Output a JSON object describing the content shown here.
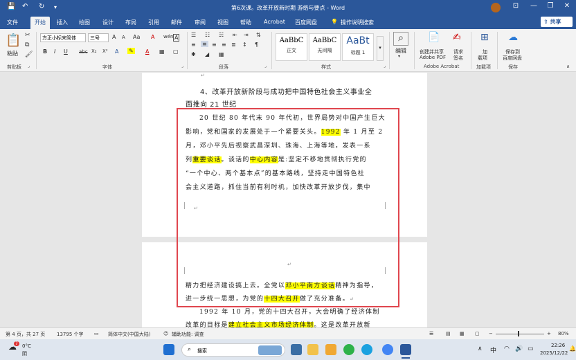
{
  "titlebar": {
    "title": "第6次课。改革开放新时期 游络与要点 - Word",
    "save_icon": "save-icon",
    "undo_icon": "undo-icon",
    "redo_icon": "redo-icon",
    "customize_icon": "chevron-down-icon",
    "minimize": "—",
    "restore": "❐",
    "close": "✕",
    "ribbon_toggle": "⊡"
  },
  "tabs": [
    "文件",
    "开始",
    "插入",
    "绘图",
    "设计",
    "布局",
    "引用",
    "邮件",
    "审阅",
    "视图",
    "帮助",
    "Acrobat",
    "百度网盘",
    "操作说明搜索"
  ],
  "active_tab": "开始",
  "share_label": "共享",
  "ribbon": {
    "clipboard": {
      "label": "剪贴板",
      "paste": "粘贴"
    },
    "font": {
      "label": "字体",
      "font_name": "方正小标宋简体",
      "font_size": "三号",
      "aa": "A",
      "wen": "wén",
      "bold": "B",
      "italic": "I",
      "underline": "U",
      "strike": "abc",
      "sub": "X₂",
      "sup": "X²",
      "font_color_a": "A",
      "grow": "A",
      "shrink": "A",
      "case": "Aa",
      "clear": "A",
      "border_a": "A"
    },
    "paragraph": {
      "label": "段落"
    },
    "styles": {
      "label": "样式",
      "items": [
        {
          "sample": "AaBbC",
          "name": "正文"
        },
        {
          "sample": "AaBbC",
          "name": "无间隔"
        },
        {
          "sample": "AaBt",
          "name": "标题 1"
        }
      ]
    },
    "editing": {
      "label": "编辑"
    },
    "acrobat": {
      "label": "Adobe Acrobat",
      "create_pdf": "创建并共享",
      "create_pdf2": "Adobe PDF",
      "request_sign": "请求",
      "request_sign2": "签名"
    },
    "addins": {
      "label": "加载项",
      "load": "加",
      "load2": "载项"
    },
    "save": {
      "label": "保存",
      "save_to": "保存到",
      "save_to2": "百度网盘"
    }
  },
  "document": {
    "heading1": "4、改革开放新阶段与成功把中国特色社会主义事业全",
    "heading2": "面推向 21 世纪",
    "p1_l1": "20 世纪 80 年代末 90 年代初，世界局势对中国产生巨大",
    "p1_l2a": "影响，党和国家的发展处于一个紧要关头。",
    "p1_l2_hl": "1992",
    "p1_l2b": " 年 1 月至 2",
    "p1_l3": "月，邓小平先后视察武昌深圳、珠海、上海等地，发表一系",
    "p1_l4a": "列",
    "p1_l4_hl1": "重要谈话",
    "p1_l4b": "。谈话的",
    "p1_l4_hl2": "中心内容",
    "p1_l4c": "是:坚定不移地贯彻执行党的",
    "p1_l5": "“一个中心、两个基本点”的基本路线，坚持走中国特色社",
    "p1_l6": "会主义道路，抓住当前有利时机，加快改革开放步伐，集中",
    "p2_l1a": "精力把经济建设搞上去。全党以",
    "p2_l1_hl": "邓小平南方谈话",
    "p2_l1b": "精神为指导，",
    "p2_l2a": "进一步统一思想，为党的",
    "p2_l2_hl": "十四大召开",
    "p2_l2b": "做了充分准备。",
    "p3_l1": "1992 年 10 月，党的十四大召开，大会明确了经济体制",
    "p3_l2a": "改革的目标是",
    "p3_l2_hl": "建立社会主义市场经济体制",
    "p3_l2b": "。这是改革开放新"
  },
  "statusbar": {
    "page": "第 4 页，共 27 页",
    "words": "13795 个字",
    "lang": "简体中文(中国大陆)",
    "accessibility": "辅助功能: 调查",
    "zoom": "80%"
  },
  "taskbar": {
    "weather_temp": "0°C",
    "weather_desc": "阴",
    "weather_badge": "7",
    "search": "搜索",
    "time": "22:26",
    "date": "2025/12/22",
    "ime": "中"
  },
  "colors": {
    "word_blue": "#2b579a",
    "highlight": "#ffff00",
    "annotation_red": "#e0464e"
  }
}
